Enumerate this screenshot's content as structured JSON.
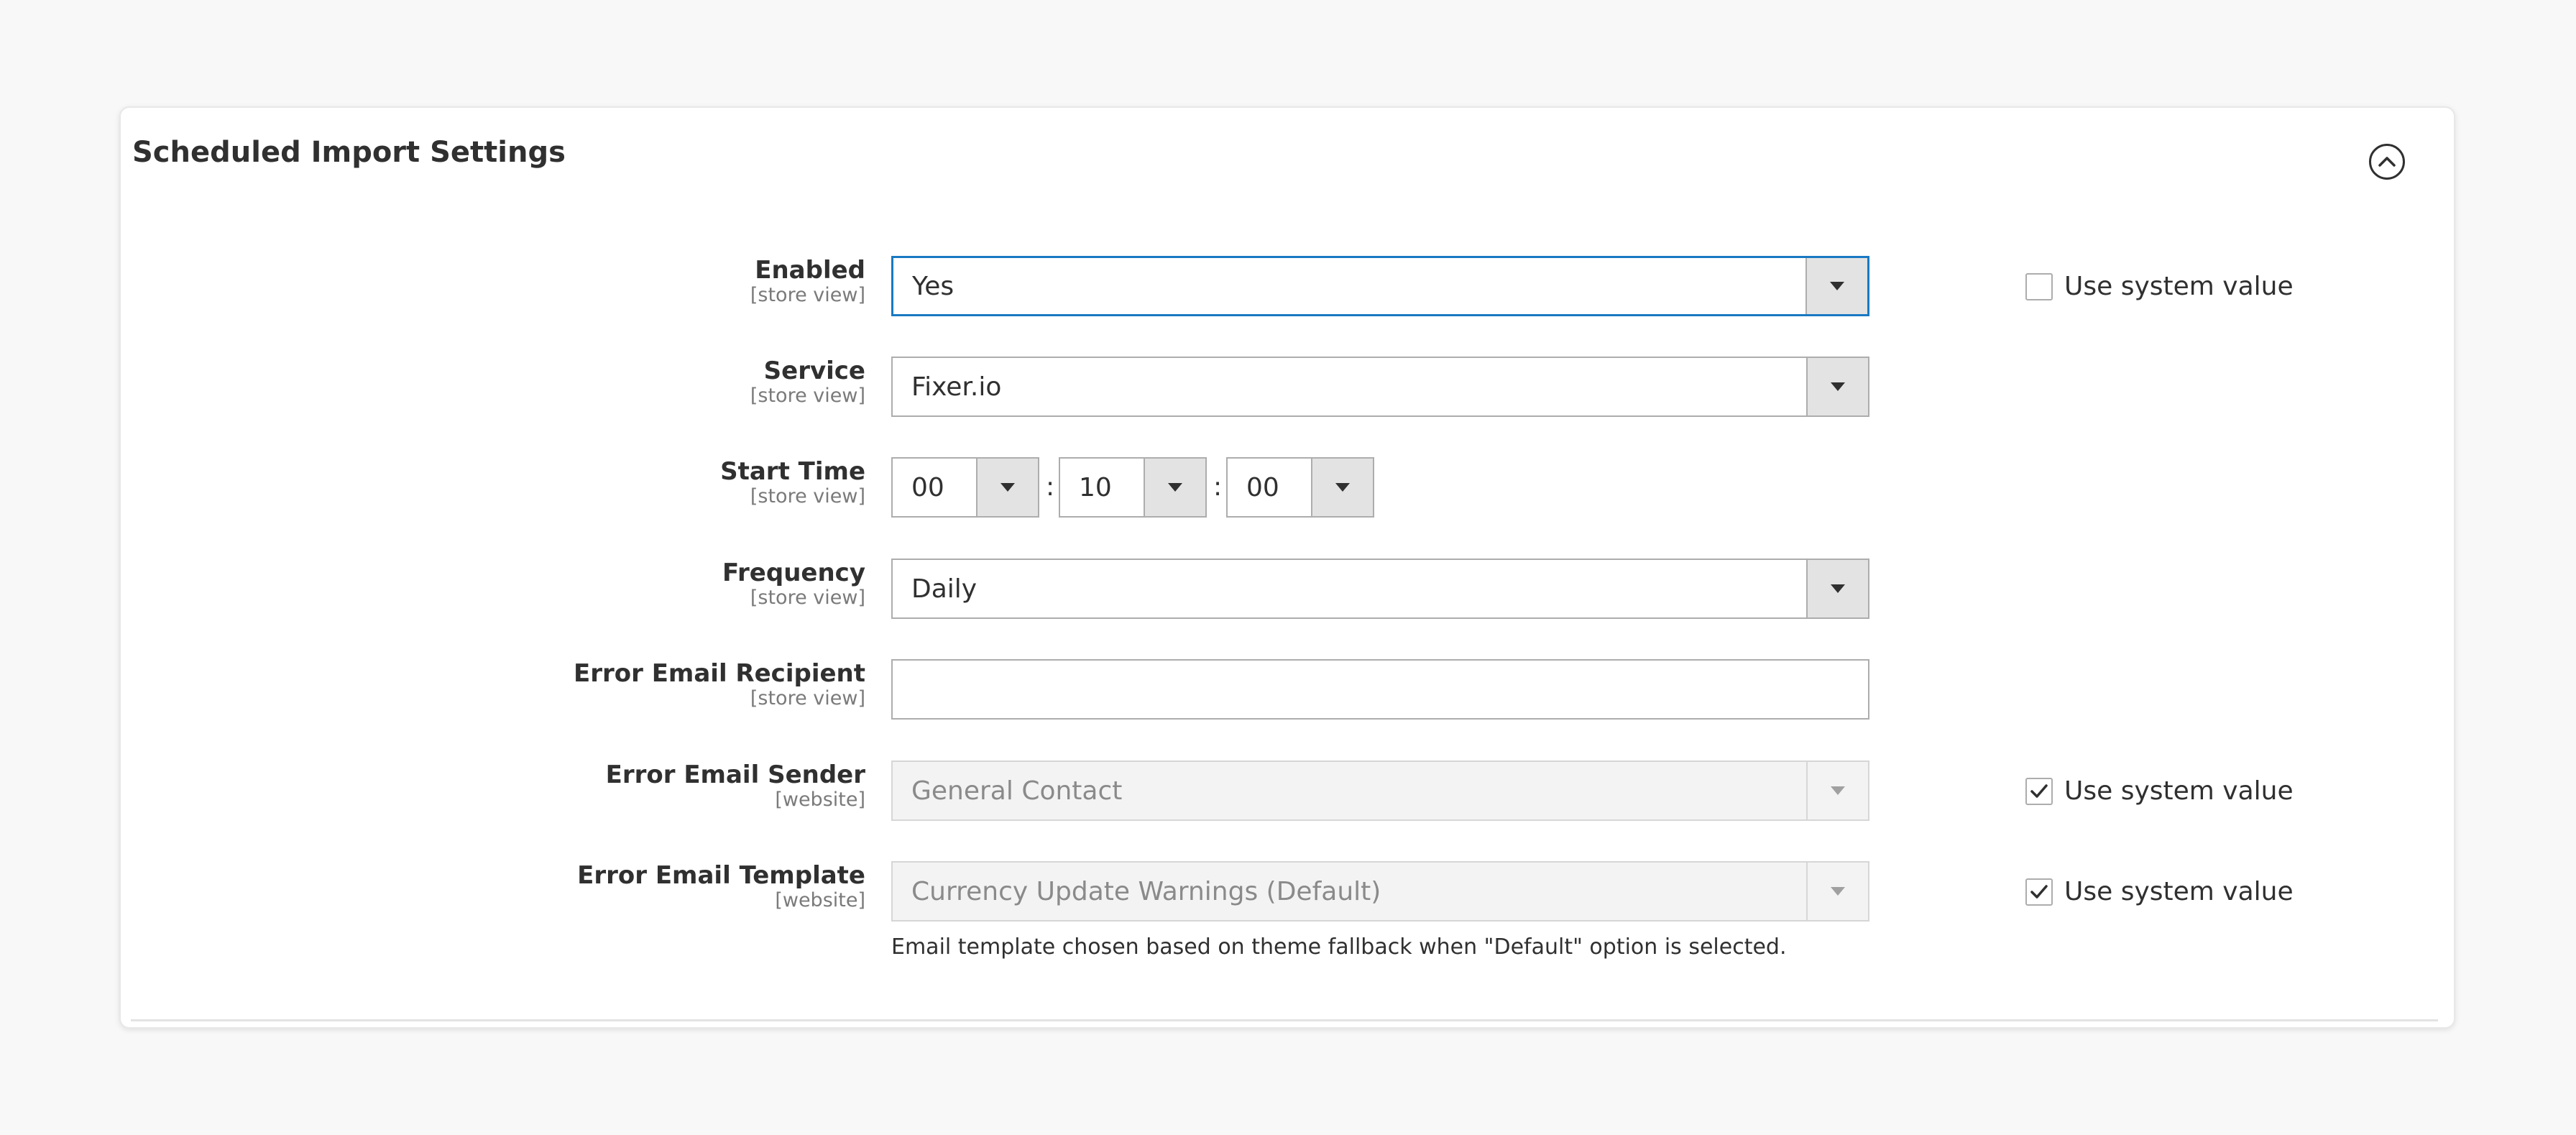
{
  "panel": {
    "title": "Scheduled Import Settings",
    "collapse_icon": "chevron-up-circle-icon"
  },
  "fields": {
    "enabled": {
      "label": "Enabled",
      "scope": "[store view]",
      "value": "Yes",
      "use_system_value": false
    },
    "service": {
      "label": "Service",
      "scope": "[store view]",
      "value": "Fixer.io"
    },
    "start_time": {
      "label": "Start Time",
      "scope": "[store view]",
      "hour": "00",
      "minute": "10",
      "second": "00",
      "separator": ":"
    },
    "frequency": {
      "label": "Frequency",
      "scope": "[store view]",
      "value": "Daily"
    },
    "error_email_recipient": {
      "label": "Error Email Recipient",
      "scope": "[store view]",
      "value": ""
    },
    "error_email_sender": {
      "label": "Error Email Sender",
      "scope": "[website]",
      "value": "General Contact",
      "use_system_value": true
    },
    "error_email_template": {
      "label": "Error Email Template",
      "scope": "[website]",
      "value": "Currency Update Warnings (Default)",
      "use_system_value": true,
      "note": "Email template chosen based on theme fallback when \"Default\" option is selected."
    }
  },
  "use_system_value_label": "Use system value",
  "colors": {
    "focus_border": "#1979c3",
    "arrow_bg": "#e3e3e3",
    "disabled_bg": "#f3f3f3"
  }
}
